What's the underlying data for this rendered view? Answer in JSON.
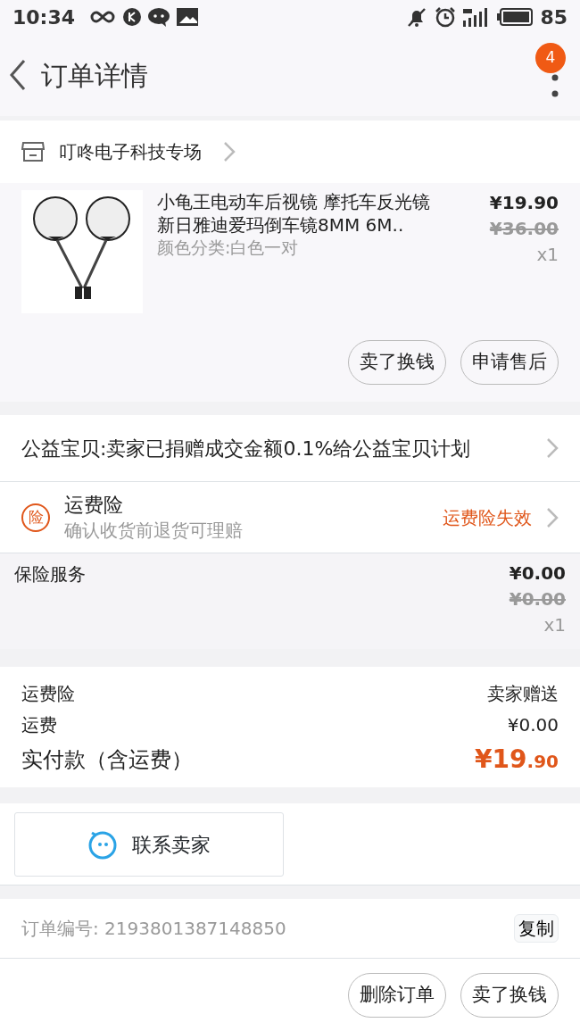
{
  "status_bar": {
    "time": "10:34",
    "battery": "85"
  },
  "header": {
    "title": "订单详情",
    "badge": "4"
  },
  "shop": {
    "name": "叮咚电子科技专场"
  },
  "product": {
    "title": "小龟王电动车后视镜 摩托车反光镜新日雅迪爱玛倒车镜8MM 6M..",
    "sku": "颜色分类:白色一对",
    "price": "¥19.90",
    "original_price": "¥36.00",
    "quantity": "x1",
    "buttons": [
      "卖了换钱",
      "申请售后"
    ]
  },
  "charity": {
    "text": "公益宝贝:卖家已捐赠成交金额0.1%给公益宝贝计划"
  },
  "insurance": {
    "icon_char": "险",
    "title": "运费险",
    "subtitle": "确认收货前退货可理赔",
    "status": "运费险失效"
  },
  "insurance_service": {
    "title": "保险服务",
    "price": "¥0.00",
    "original_price": "¥0.00",
    "quantity": "x1"
  },
  "summary": [
    {
      "label": "运费险",
      "value": "卖家赠送",
      "kind": "plain"
    },
    {
      "label": "运费",
      "value": "¥0.00",
      "kind": "plain"
    },
    {
      "label": "实付款（含运费）",
      "value": "¥19",
      "cents": ".90",
      "kind": "total"
    }
  ],
  "contact": {
    "label": "联系卖家"
  },
  "order": {
    "label": "订单编号: 2193801387148850",
    "copy": "复制"
  },
  "bottom_buttons": [
    "删除订单",
    "卖了换钱"
  ]
}
